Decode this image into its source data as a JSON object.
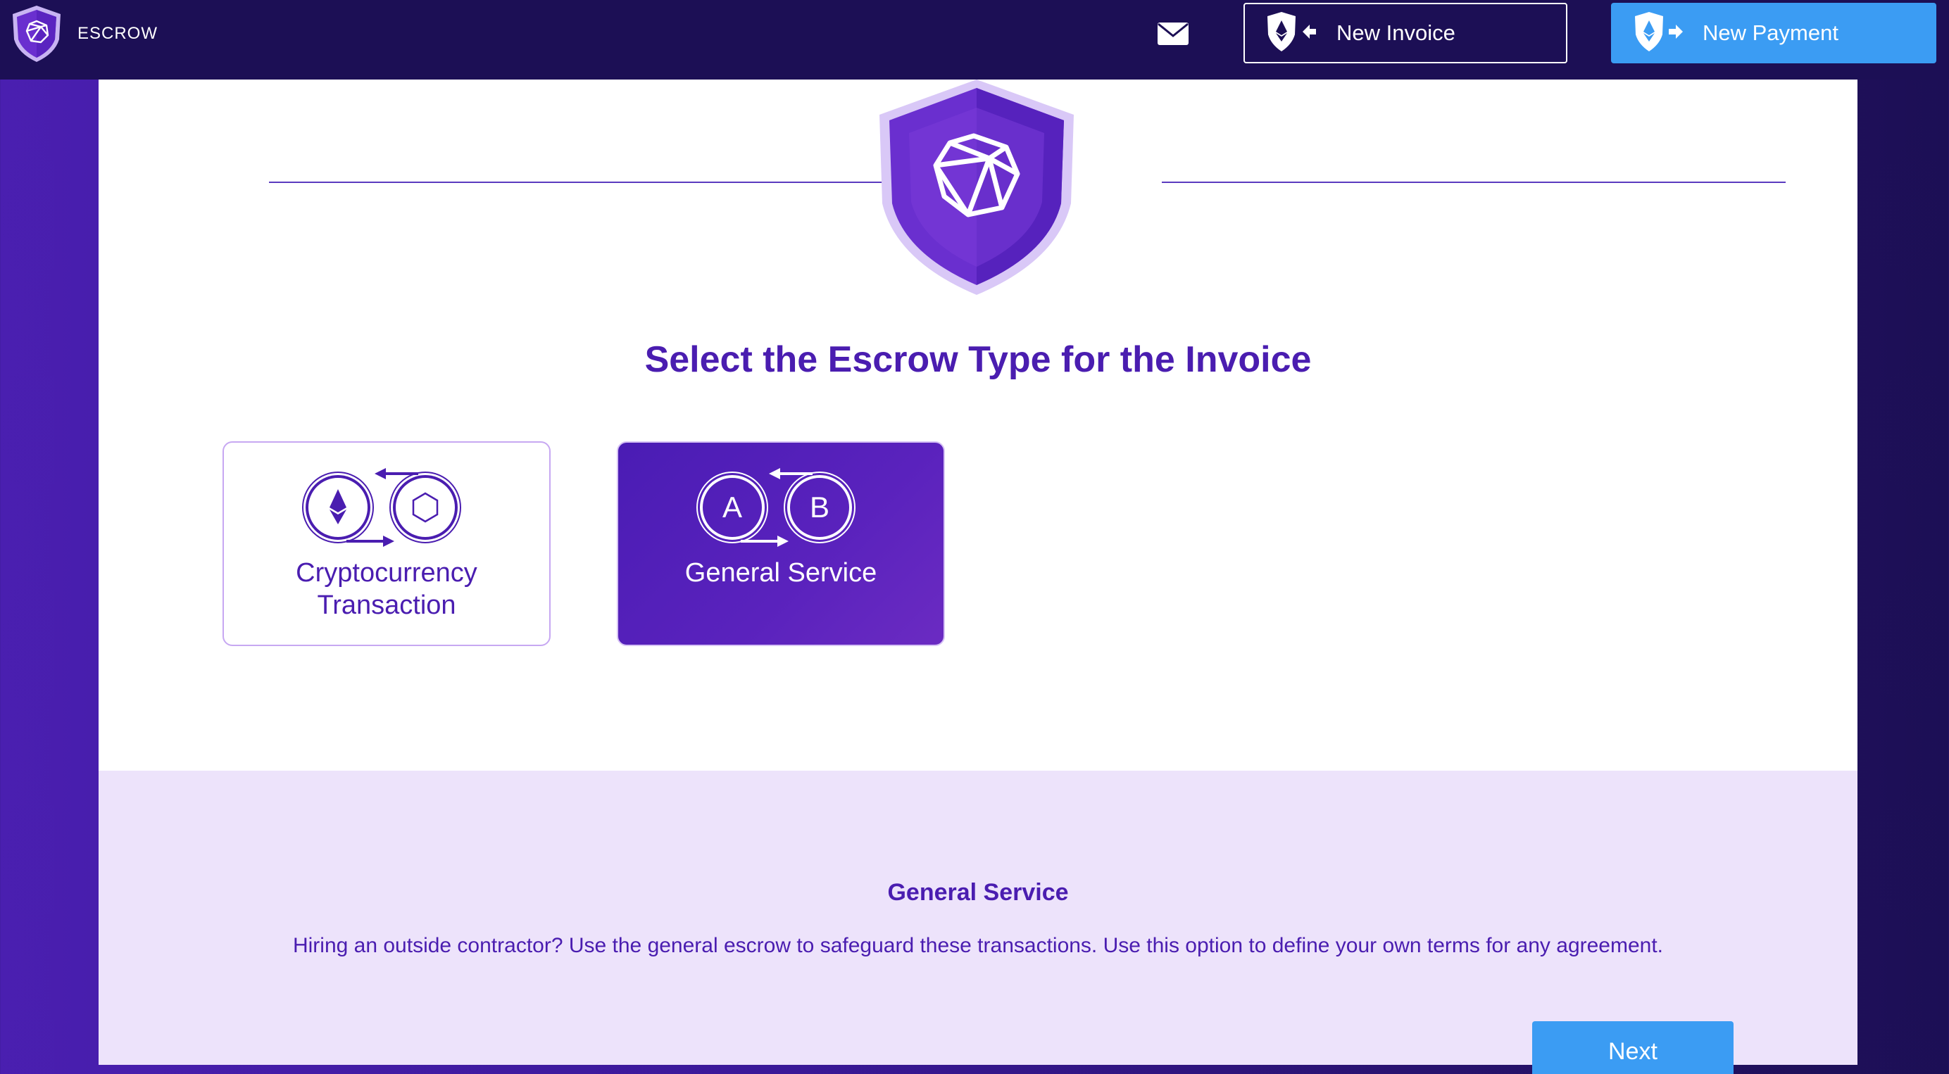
{
  "topbar": {
    "brand": "ESCROW",
    "new_invoice_label": "New Invoice",
    "new_payment_label": "New Payment"
  },
  "main": {
    "title": "Select the Escrow Type for the Invoice",
    "options": [
      {
        "label_line1": "Cryptocurrency",
        "label_line2": "Transaction",
        "selected": false
      },
      {
        "label": "General Service",
        "badge_a": "A",
        "badge_b": "B",
        "selected": true
      }
    ]
  },
  "info": {
    "title": "General Service",
    "description": "Hiring an outside contractor? Use the general escrow to safeguard these transactions. Use this option to define your own terms for any agreement."
  },
  "actions": {
    "next_label": "Next"
  },
  "colors": {
    "primary": "#4a1db0",
    "accent_blue": "#3b9cf3",
    "nav_bg": "#1c0f55",
    "info_bg": "#ede3fb"
  },
  "icons": [
    "escrow-logo-icon",
    "mail-icon",
    "invoice-icon",
    "payment-icon",
    "escrow-shield-icon",
    "ethereum-icon",
    "token-hexagon-icon",
    "swap-arrows-icon"
  ]
}
